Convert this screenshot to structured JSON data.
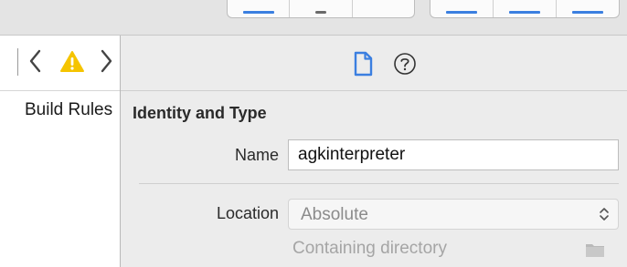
{
  "jump_bar": {
    "back_icon": "chevron-left-icon",
    "warning_icon": "warning-icon",
    "forward_icon": "chevron-right-icon"
  },
  "editor": {
    "tab_label": "Build Rules"
  },
  "inspector": {
    "tabs": [
      {
        "name": "file-inspector",
        "icon": "file-icon",
        "selected": true
      },
      {
        "name": "quick-help",
        "icon": "question-icon",
        "selected": false
      }
    ],
    "section_title": "Identity and Type",
    "name_label": "Name",
    "name_value": "agkinterpreter",
    "location_label": "Location",
    "location_value": "Absolute",
    "containing_directory": "Containing directory"
  },
  "colors": {
    "accent": "#3b7fe0",
    "warning": "#f5c400"
  }
}
